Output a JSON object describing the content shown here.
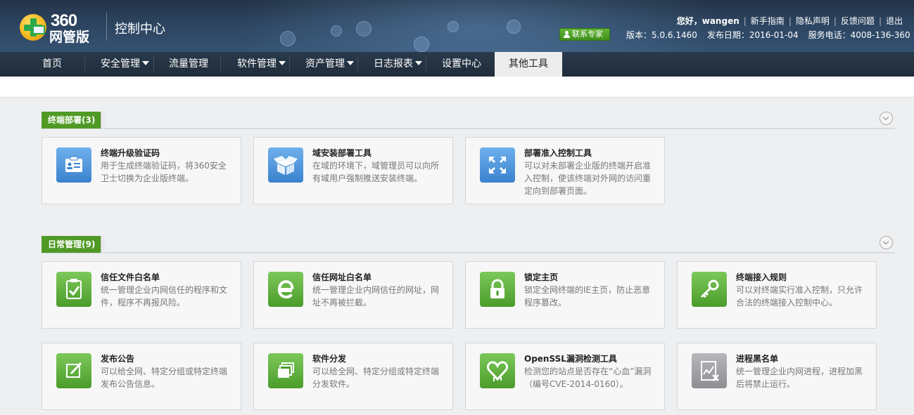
{
  "header": {
    "logo_number": "360",
    "logo_name": "网管版",
    "app_title": "控制中心",
    "greeting": "您好，wangen",
    "links": [
      "新手指南",
      "隐私声明",
      "反馈问题",
      "退出"
    ],
    "contact_label": "联系专家",
    "version": "版本：5.0.6.1460",
    "release_date": "发布日期：2016-01-04",
    "phone": "服务电话：4008-136-360"
  },
  "nav": {
    "items": [
      {
        "label": "首页"
      },
      {
        "label": "安全管理"
      },
      {
        "label": "流量管理"
      },
      {
        "label": "软件管理"
      },
      {
        "label": "资产管理"
      },
      {
        "label": "日志报表"
      },
      {
        "label": "设置中心"
      },
      {
        "label": "其他工具"
      }
    ],
    "active": "其他工具"
  },
  "sections": [
    {
      "title": "终端部署(3)",
      "cards": [
        {
          "title": "终端升级验证码",
          "desc": "用于生成终端验证码，将360安全卫士切换为企业版终端。",
          "icon": "id-card-icon",
          "color": "blue"
        },
        {
          "title": "域安装部署工具",
          "desc": "在域的环境下，域管理员可以向所有域用户强制推送安装终端。",
          "icon": "box-icon",
          "color": "blue"
        },
        {
          "title": "部署准入控制工具",
          "desc": "可以对未部署企业版的终端开启准入控制，使该终端对外网的访问重定向到部署页面。",
          "icon": "expand-arrows-icon",
          "color": "blue"
        }
      ]
    },
    {
      "title": "日常管理(9)",
      "cards": [
        {
          "title": "信任文件白名单",
          "desc": "统一管理企业内网信任的程序和文件，程序不再报风险。",
          "icon": "clipboard-check-icon",
          "color": "green"
        },
        {
          "title": "信任网址白名单",
          "desc": "统一管理企业内网信任的网址，网址不再被拦截。",
          "icon": "ie-icon",
          "color": "green"
        },
        {
          "title": "锁定主页",
          "desc": "锁定全网终端的IE主页，防止恶意程序篡改。",
          "icon": "lock-icon",
          "color": "green"
        },
        {
          "title": "终端接入规则",
          "desc": "可以对终端实行准入控制，只允许合法的终端接入控制中心。",
          "icon": "key-icon",
          "color": "green"
        },
        {
          "title": "发布公告",
          "desc": "可以给全网、特定分组或特定终端发布公告信息。",
          "icon": "edit-icon",
          "color": "green"
        },
        {
          "title": "软件分发",
          "desc": "可以给全网、特定分组或特定终端分发软件。",
          "icon": "stack-icon",
          "color": "green"
        },
        {
          "title": "OpenSSL漏洞检测工具",
          "desc": "检测您的站点是否存在“心血”漏洞（编号CVE-2014-0160）。",
          "icon": "bleeding-heart-icon",
          "color": "green"
        },
        {
          "title": "进程黑名单",
          "desc": "统一管理企业内网进程，进程加黑后将禁止运行。",
          "icon": "blocked-process-icon",
          "color": "gray"
        }
      ]
    }
  ]
}
